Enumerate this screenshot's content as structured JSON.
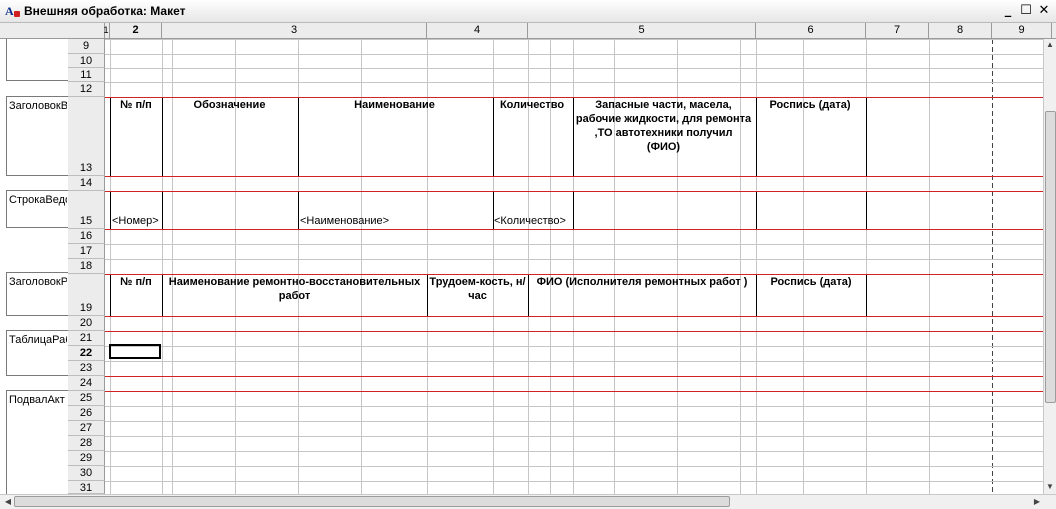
{
  "window": {
    "title": "Внешняя обработка: Макет",
    "minimize": "_",
    "maximize": "☐",
    "close": "✕"
  },
  "columns": [
    "1",
    "2",
    "3",
    "4",
    "5",
    "6",
    "7",
    "8",
    "9"
  ],
  "rows": [
    "9",
    "10",
    "11",
    "12",
    "13",
    "14",
    "15",
    "16",
    "17",
    "18",
    "19",
    "20",
    "21",
    "22",
    "23",
    "24",
    "25",
    "26",
    "27",
    "28",
    "29",
    "30",
    "31"
  ],
  "area_labels": [
    "ЗаголовокВ",
    "СтрокаВедо",
    "ЗаголовокР",
    "ТаблицаРаб",
    "ПодвалАкт"
  ],
  "header1": {
    "num": "№ п/п",
    "designation": "Обозначение",
    "name": "Наименование",
    "qty": "Количество",
    "parts": "Запасные части, масела, рабочие жидкости, для ремонта ,ТО  автотехники получил\n(ФИО)",
    "sign": "Роспись (дата)"
  },
  "row15": {
    "num": "<Номер>",
    "name": "<Наименование>",
    "qty": "<Количество>"
  },
  "header2": {
    "num": "№ п/п",
    "work": "Наименование ремонтно-восстановительных работ",
    "labor": "Трудоем-кость, н/час",
    "fio": "ФИО (Исполнителя ремонтных работ )",
    "sign": "Роспись (дата)"
  },
  "scroll": {
    "up": "▲",
    "down": "▼",
    "left": "◀",
    "right": "▶"
  }
}
